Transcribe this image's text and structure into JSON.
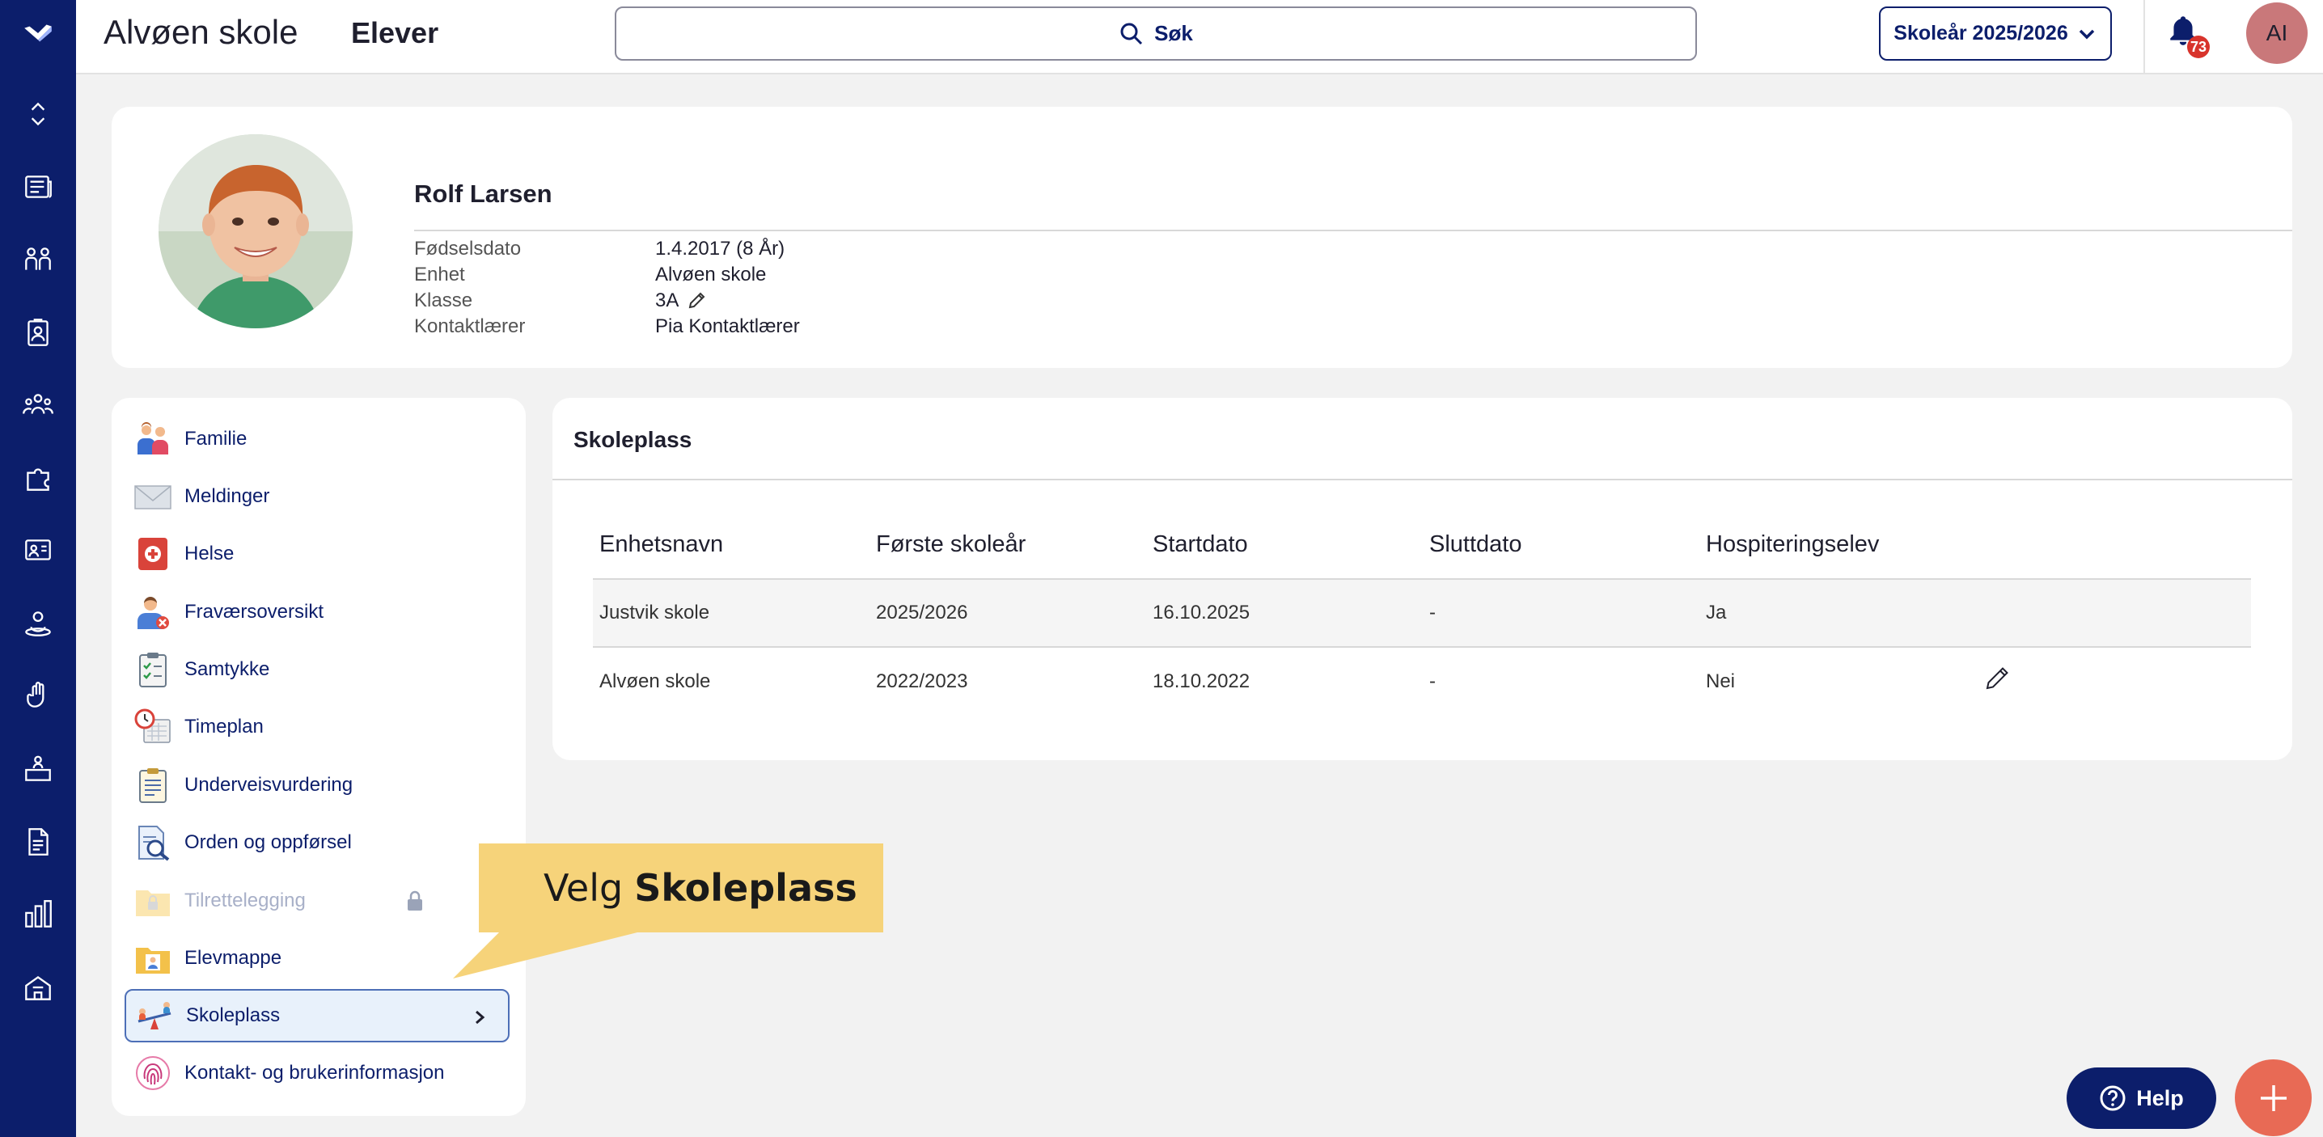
{
  "app": {
    "title": "Alvøen skole",
    "page": "Elever"
  },
  "search": {
    "label": "Søk"
  },
  "year_select": {
    "label": "Skoleår 2025/2026"
  },
  "notifications": {
    "count": "73"
  },
  "user": {
    "initials": "AI"
  },
  "rail": {
    "icons": [
      "logo-icon",
      "expand-collapse-icon",
      "newspaper-icon",
      "people-icon",
      "clipboard-badge-icon",
      "group-icon",
      "puzzle-icon",
      "board-icon",
      "person-shared-icon",
      "hand-raised-icon",
      "desk-icon",
      "document-icon",
      "bar-chart-icon",
      "school-building-icon"
    ]
  },
  "student": {
    "name": "Rolf Larsen",
    "fields": [
      {
        "label": "Fødselsdato",
        "value": "1.4.2017 (8 År)"
      },
      {
        "label": "Enhet",
        "value": "Alvøen skole"
      },
      {
        "label": "Klasse",
        "value": "3A"
      },
      {
        "label": "Kontaktlærer",
        "value": "Pia Kontaktlærer"
      }
    ]
  },
  "menu": {
    "items": [
      {
        "label": "Familie",
        "icon": "family-icon"
      },
      {
        "label": "Meldinger",
        "icon": "envelope-icon"
      },
      {
        "label": "Helse",
        "icon": "health-icon"
      },
      {
        "label": "Fraværsoversikt",
        "icon": "absence-icon"
      },
      {
        "label": "Samtykke",
        "icon": "consent-clipboard-icon"
      },
      {
        "label": "Timeplan",
        "icon": "schedule-icon"
      },
      {
        "label": "Underveisvurdering",
        "icon": "assessment-icon"
      },
      {
        "label": "Orden og oppførsel",
        "icon": "conduct-icon"
      },
      {
        "label": "Tilrettelegging",
        "icon": "locked-folder-icon"
      },
      {
        "label": "Elevmappe",
        "icon": "student-folder-icon"
      },
      {
        "label": "Skoleplass",
        "icon": "seesaw-icon"
      },
      {
        "label": "Kontakt- og brukerinformasjon",
        "icon": "fingerprint-icon"
      }
    ]
  },
  "school": {
    "title": "Skoleplass",
    "columns": [
      "Enhetsnavn",
      "Første skoleår",
      "Startdato",
      "Sluttdato",
      "Hospiteringselev"
    ],
    "rows": [
      [
        "Justvik skole",
        "2025/2026",
        "16.10.2025",
        "-",
        "Ja"
      ],
      [
        "Alvøen skole",
        "2022/2023",
        "18.10.2022",
        "-",
        "Nei"
      ]
    ]
  },
  "callout": {
    "prefix": "Velg",
    "bold": "Skoleplass"
  },
  "help": {
    "label": "Help"
  },
  "colors": {
    "navy": "#0c1e6b",
    "accent": "#e86a55",
    "callout": "#f6d37a",
    "badge": "#d8342c"
  }
}
